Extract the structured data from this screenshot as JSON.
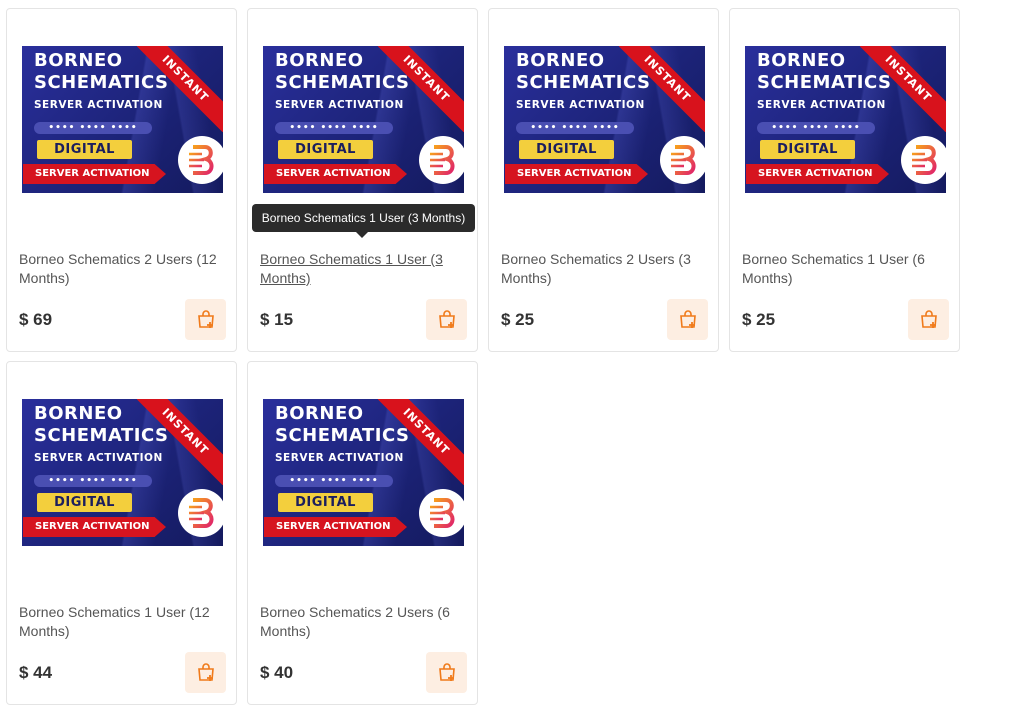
{
  "banner": {
    "title_line1": "BORNEO",
    "title_line2": "SCHEMATICS",
    "subtitle": "SERVER ACTIVATION",
    "code": "•••• •••• ••••",
    "digital": "DIGITAL",
    "ribbon": "SERVER ACTIVATION",
    "corner": "INSTANT"
  },
  "tooltip": "Borneo Schematics 1 User (3 Months)",
  "products": [
    {
      "name": "Borneo Schematics 2 Users (12 Months)",
      "price": "$ 69"
    },
    {
      "name": "Borneo Schematics 1 User (3 Months)",
      "price": "$ 15"
    },
    {
      "name": "Borneo Schematics 2 Users (3 Months)",
      "price": "$ 25"
    },
    {
      "name": "Borneo Schematics 1 User (6 Months)",
      "price": "$ 25"
    },
    {
      "name": "Borneo Schematics 1 User (12 Months)",
      "price": "$ 44"
    },
    {
      "name": "Borneo Schematics 2 Users (6 Months)",
      "price": "$ 40"
    }
  ],
  "colors": {
    "cart_bg": "#fdeee2",
    "cart_icon": "#f07a1a",
    "banner_bg": "#1c2378",
    "ribbon_red": "#d6141f",
    "digital_yellow": "#f3cf3d"
  },
  "icons": {
    "cart": "shopping-bag-plus-icon",
    "logo": "borneo-b-logo"
  }
}
